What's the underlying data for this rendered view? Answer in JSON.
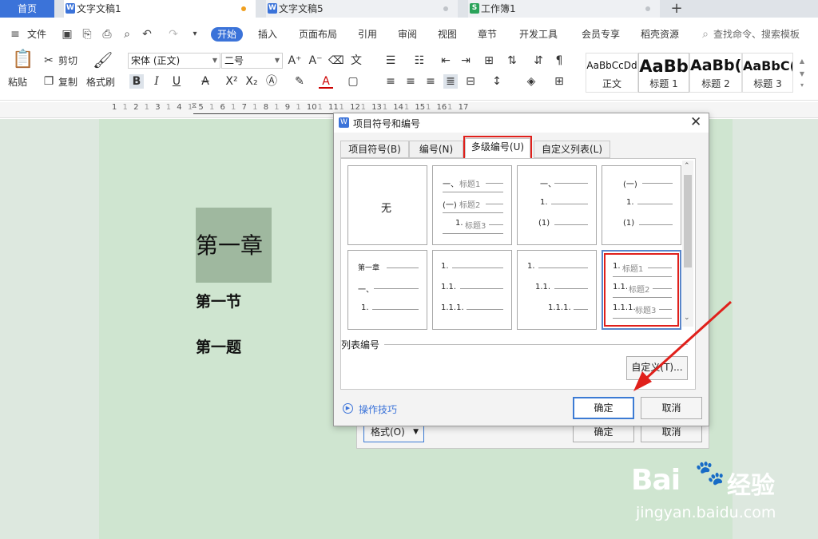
{
  "tabs": {
    "home": "首页",
    "doc1": "文字文稿1",
    "doc5": "文字文稿5",
    "sheet": "工作簿1",
    "new_tab": "+"
  },
  "menu": {
    "file": "文件",
    "start": "开始",
    "insert": "插入",
    "layout": "页面布局",
    "reference": "引用",
    "review": "审阅",
    "view": "视图",
    "chapter": "章节",
    "dev": "开发工具",
    "vip": "会员专享",
    "resource": "稻壳资源",
    "search_placeholder": "查找命令、搜索模板"
  },
  "ribbon": {
    "paste": "粘贴",
    "cut": "剪切",
    "copy": "复制",
    "format_painter": "格式刷",
    "font_name": "宋体 (正文)",
    "font_size": "二号",
    "bold": "B",
    "italic": "I",
    "underline": "U",
    "styles": [
      {
        "sample": "AaBbCcDd",
        "label": "正文"
      },
      {
        "sample": "AaBb",
        "label": "标题 1"
      },
      {
        "sample": "AaBb(",
        "label": "标题 2"
      },
      {
        "sample": "AaBbC(",
        "label": "标题 3"
      }
    ]
  },
  "ruler": [
    "1",
    "1",
    "2",
    "1",
    "3",
    "1",
    "4",
    "1",
    "5",
    "1",
    "6",
    "1",
    "7",
    "1",
    "8",
    "1",
    "9",
    "1",
    "10",
    "1",
    "11",
    "1",
    "12",
    "1",
    "13",
    "1",
    "14",
    "1",
    "15",
    "1",
    "16",
    "1",
    "17"
  ],
  "document": {
    "chapter": "第一章",
    "section": "第一节",
    "question": "第一题"
  },
  "dialog": {
    "title": "项目符号和编号",
    "tabs": [
      "项目符号(B)",
      "编号(N)",
      "多级编号(U)",
      "自定义列表(L)"
    ],
    "active_tab": 2,
    "cells": {
      "none": "无",
      "c2": [
        "一、",
        "标题1",
        "(一)",
        "标题2",
        "1.",
        "标题3"
      ],
      "c3": [
        "一、",
        "1.",
        "(1)"
      ],
      "c4": [
        "(一)",
        "1.",
        "(1)"
      ],
      "c5": [
        "第一章",
        "一、",
        "1."
      ],
      "c6": [
        "1.",
        "1.1.",
        "1.1.1."
      ],
      "c7": [
        "1.",
        "1.1.",
        "1.1.1."
      ],
      "c8": [
        "1.",
        "标题1",
        "1.1.",
        "标题2",
        "1.1.1.",
        "标题3"
      ]
    },
    "list_numbering": "列表编号",
    "custom_button": "自定义(T)...",
    "tips": "操作技巧",
    "ok": "确定",
    "cancel": "取消"
  },
  "back_dialog": {
    "format": "格式(O)",
    "ok": "确定",
    "cancel": "取消"
  },
  "watermark": {
    "brand_left": "Bai",
    "brand_right": "经验",
    "url": "jingyan.baidu.com"
  },
  "colors": {
    "accent": "#3b73d9",
    "highlight_red": "#e0201b",
    "page_green": "#cfe5d0"
  }
}
